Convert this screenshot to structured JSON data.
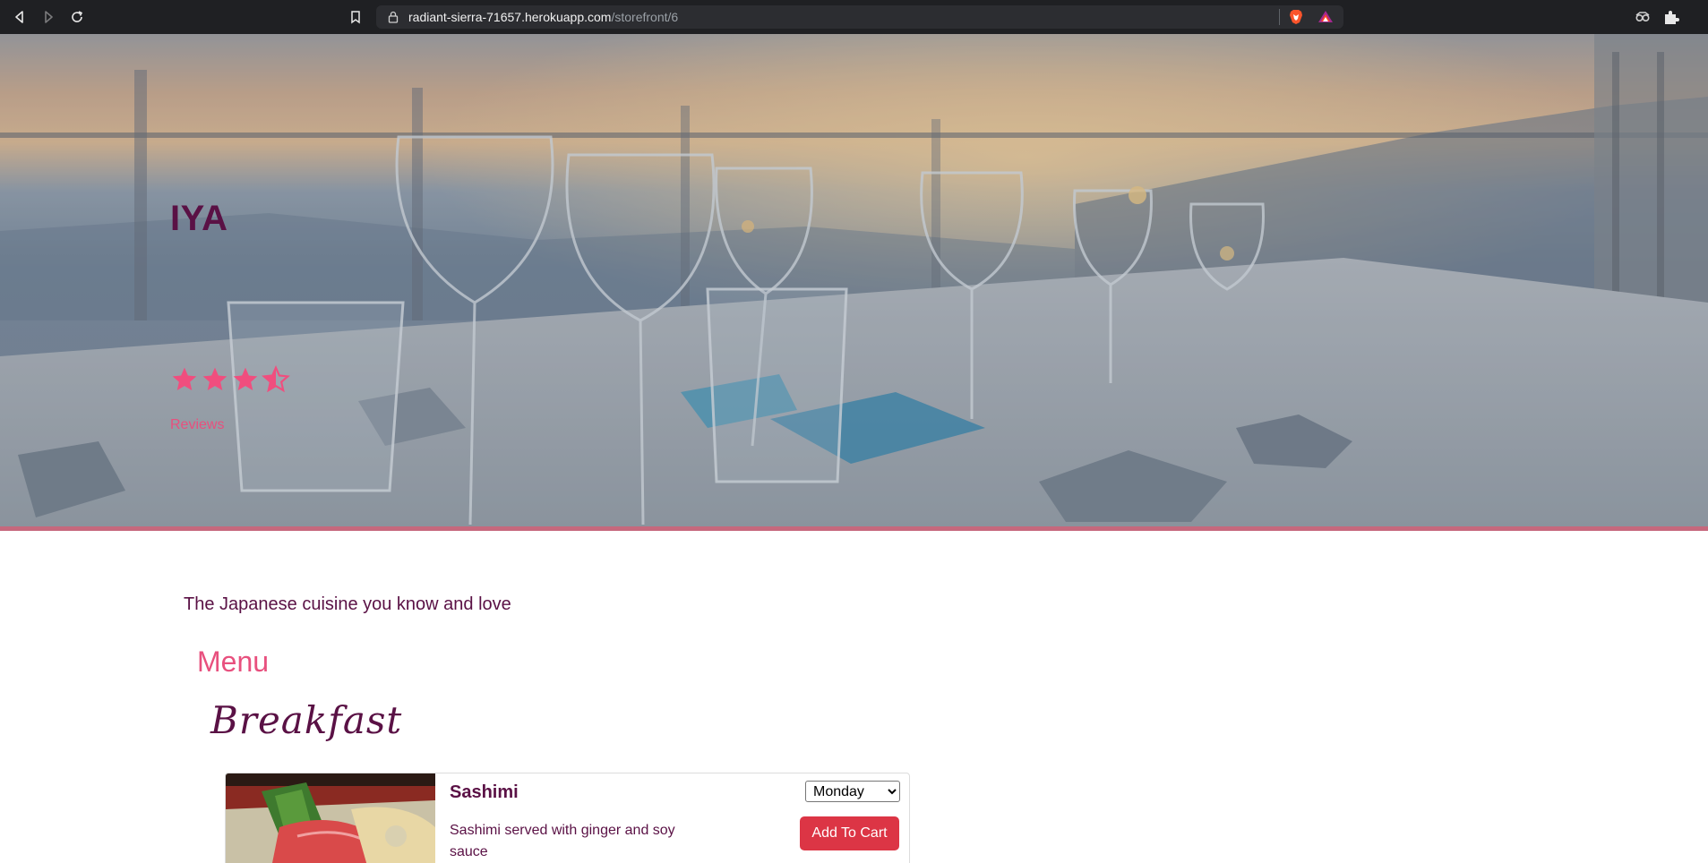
{
  "browser": {
    "url_host": "radiant-sierra-71657.herokuapp.com",
    "url_path": "/storefront/6",
    "icons": [
      "back-icon",
      "forward-icon",
      "reload-icon",
      "bookmark-icon",
      "lock-icon",
      "brave-shield-icon",
      "brave-rewards-icon",
      "extension-icon",
      "puzzle-icon"
    ]
  },
  "hero": {
    "store_name": "IYA",
    "rating": 3.5,
    "rating_max": 5,
    "reviews_label": "Reviews",
    "border_color": "#c6687d"
  },
  "content": {
    "tagline": "The Japanese cuisine you know and love",
    "menu_heading": "Menu",
    "section_heading": "Breakfast"
  },
  "items": [
    {
      "title": "Sashimi",
      "description": "Sashimi served with ginger and soy sauce",
      "selected_day": "Monday",
      "add_label": "Add To Cart"
    }
  ],
  "colors": {
    "brand_dark": "#5a1145",
    "brand_pink": "#e8507e",
    "button_red": "#dc3545"
  }
}
